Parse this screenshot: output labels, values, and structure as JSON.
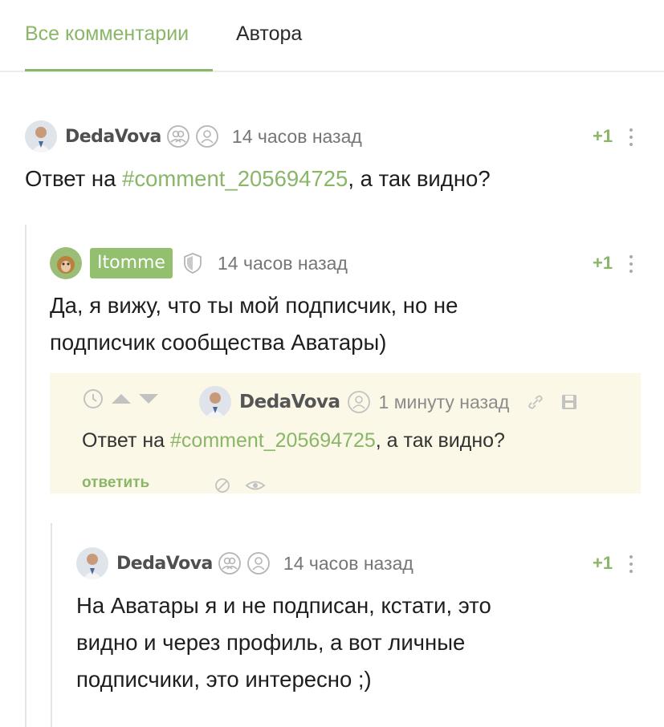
{
  "tabs": {
    "all": "Все комментарии",
    "author": "Автора"
  },
  "colors": {
    "accent": "#8ab668",
    "quote_bg": "#fbf8e7",
    "tag_bg": "#92c06e"
  },
  "comments": [
    {
      "user": "DedaVova",
      "time": "14 часов назад",
      "vote": "+1",
      "text_prefix": "Ответ на ",
      "link": "#comment_205694725",
      "text_suffix": ", а так видно?"
    },
    {
      "user": "Itomme",
      "time": "14 часов назад",
      "vote": "+1",
      "text_line1": "Да,  я вижу,  что ты мой подписчик,  но не",
      "text_line2": "подписчик сообщества Аватары)"
    },
    {
      "user": "DedaVova",
      "time": "14 часов назад",
      "vote": "+1",
      "text_line1": "На Аватары я и не подписан, кстати, это",
      "text_line2": "видно и через профиль, а вот личные",
      "text_line3": "подписчики, это интересно ;)"
    }
  ],
  "quote": {
    "user": "DedaVova",
    "time": "1 минуту назад",
    "text_prefix": "Ответ на ",
    "link": "#comment_205694725",
    "text_suffix": ", а так видно?",
    "reply": "ответить"
  },
  "icons": [
    "users-icon",
    "user-icon",
    "shield-icon",
    "more-icon",
    "clock-icon",
    "arrow-up-icon",
    "arrow-down-icon",
    "link-icon",
    "save-icon",
    "block-icon",
    "eye-icon"
  ]
}
